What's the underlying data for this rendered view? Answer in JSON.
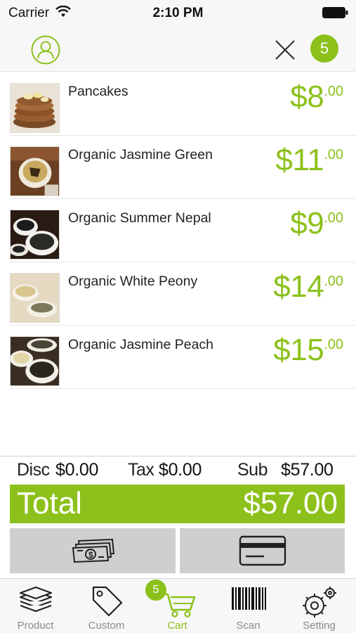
{
  "status_bar": {
    "carrier": "Carrier",
    "time": "2:10 PM"
  },
  "header": {
    "cart_count": "5",
    "icons": [
      "user-icon",
      "close-icon"
    ]
  },
  "colors": {
    "accent": "#8cc11b",
    "button_gray": "#cfcfcf"
  },
  "cart": {
    "items": [
      {
        "name": "Pancakes",
        "price": "$8",
        "cents": ".00",
        "thumb_icon": "pancakes-photo"
      },
      {
        "name": "Organic Jasmine Green",
        "price": "$11",
        "cents": ".00",
        "thumb_icon": "tea-cup-photo"
      },
      {
        "name": "Organic Summer Nepal",
        "price": "$9",
        "cents": ".00",
        "thumb_icon": "tea-leaves-photo"
      },
      {
        "name": "Organic White Peony",
        "price": "$14",
        "cents": ".00",
        "thumb_icon": "tea-cup-photo"
      },
      {
        "name": "Organic Jasmine Peach",
        "price": "$15",
        "cents": ".00",
        "thumb_icon": "tea-bowls-photo"
      }
    ]
  },
  "totals": {
    "disc_label": "Disc",
    "disc_value": "$0.00",
    "tax_label": "Tax",
    "tax_value": "$0.00",
    "sub_label": "Sub",
    "sub_value": "$57.00",
    "total_label": "Total",
    "total_value": "$57.00"
  },
  "payment": {
    "icons": [
      "cash-icon",
      "credit-card-icon"
    ]
  },
  "tabs": [
    {
      "label": "Product",
      "icon": "layers-icon",
      "active": false
    },
    {
      "label": "Custom",
      "icon": "tag-icon",
      "active": false
    },
    {
      "label": "Cart",
      "icon": "cart-icon",
      "active": true,
      "badge": "5"
    },
    {
      "label": "Scan",
      "icon": "barcode-icon",
      "active": false
    },
    {
      "label": "Setting",
      "icon": "gear-icon",
      "active": false
    }
  ]
}
